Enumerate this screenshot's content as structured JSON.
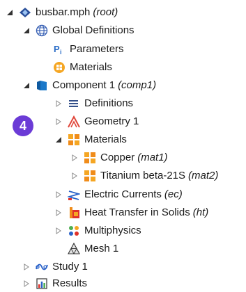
{
  "tree": {
    "root": {
      "label": "busbar.mph",
      "tag": "(root)"
    },
    "global_definitions": {
      "label": "Global Definitions"
    },
    "parameters": {
      "label": "Parameters"
    },
    "global_materials": {
      "label": "Materials"
    },
    "component": {
      "label": "Component 1",
      "tag": "(comp1)"
    },
    "definitions": {
      "label": "Definitions"
    },
    "geometry": {
      "label": "Geometry 1"
    },
    "materials": {
      "label": "Materials"
    },
    "copper": {
      "label": "Copper",
      "tag": "(mat1)"
    },
    "titanium": {
      "label": "Titanium beta-21S",
      "tag": "(mat2)"
    },
    "electric_currents": {
      "label": "Electric Currents",
      "tag": "(ec)"
    },
    "heat_transfer": {
      "label": "Heat Transfer in Solids",
      "tag": "(ht)"
    },
    "multiphysics": {
      "label": "Multiphysics"
    },
    "mesh": {
      "label": "Mesh 1"
    },
    "study": {
      "label": "Study 1"
    },
    "results": {
      "label": "Results"
    }
  },
  "badge": {
    "number": "4"
  }
}
